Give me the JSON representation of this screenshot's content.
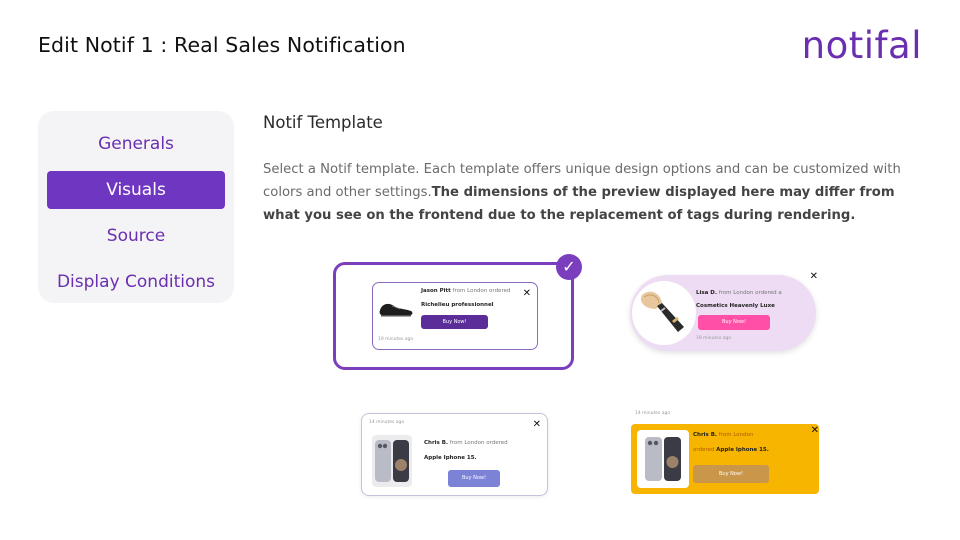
{
  "header": {
    "title": "Edit Notif 1 : Real Sales Notification",
    "logo_text": "notifal"
  },
  "sidebar": {
    "items": [
      {
        "label": "Generals",
        "active": false
      },
      {
        "label": "Visuals",
        "active": true
      },
      {
        "label": "Source",
        "active": false
      },
      {
        "label": "Display Conditions",
        "active": false
      }
    ]
  },
  "section": {
    "title": "Notif Template",
    "description": "Select a Notif template. Each template offers unique design options and can be customized with colors and other settings.",
    "description_bold": "The dimensions of the preview displayed here may differ from what you see on the frontend due to the replacement of tags during rendering."
  },
  "templates": [
    {
      "name": "Jason Pitt",
      "from_text": "from London ordered",
      "product": "Richelieu professionnel",
      "button": "Buy Now!",
      "time": "19 minutes ago",
      "selected": true
    },
    {
      "name": "Lisa D.",
      "from_text": "from London ordered a",
      "product": "Cosmetics Heavenly Luxe",
      "button": "Buy Now!",
      "time": "19 minutes ago"
    },
    {
      "name": "Chris B.",
      "from_text": "from London ordered",
      "product": "Apple Iphone 15.",
      "button": "Buy Now!",
      "time": "14 minutes ago"
    },
    {
      "name": "Chris B.",
      "from_text": "from London",
      "from_text_2": "ordered",
      "product": "Apple Iphone 15.",
      "button": "Buy Now!",
      "time": "14 minutes ago"
    }
  ],
  "colors": {
    "brand": "#6a2fb0",
    "active_nav": "#6f36c1",
    "selected_border": "#7b3fbe",
    "t1_button": "#5a2d99",
    "t2_bg": "#eddcf3",
    "t2_button": "#ff4fa6",
    "t3_button": "#7c82d6",
    "t4_bg": "#f7b500",
    "t4_button": "#c9964a"
  },
  "icons": {
    "check": "check-icon",
    "close": "close-icon"
  }
}
